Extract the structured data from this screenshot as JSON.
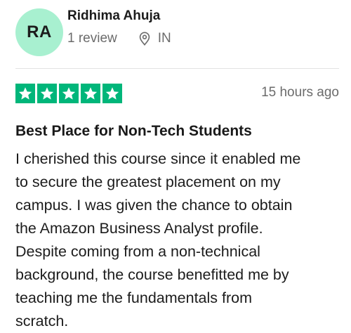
{
  "reviewer": {
    "initials": "RA",
    "name": "Ridhima Ahuja",
    "review_count": "1 review",
    "location_icon": "location-pin-icon",
    "country": "IN",
    "avatar_color": "#a8f0d0"
  },
  "rating": {
    "stars": 5,
    "max": 5,
    "star_color": "#00b67a",
    "star_icon": "star-icon"
  },
  "timestamp": "15 hours ago",
  "review": {
    "title": "Best Place for Non-Tech Students",
    "body_lines": [
      "I cherished this course since it enabled me",
      "to secure the greatest placement on my",
      "campus. I was given the chance to obtain",
      "the Amazon Business Analyst profile.",
      "Despite coming from a non-technical",
      "background, the course benefitted me by",
      "teaching me the fundamentals from",
      "scratch."
    ]
  }
}
